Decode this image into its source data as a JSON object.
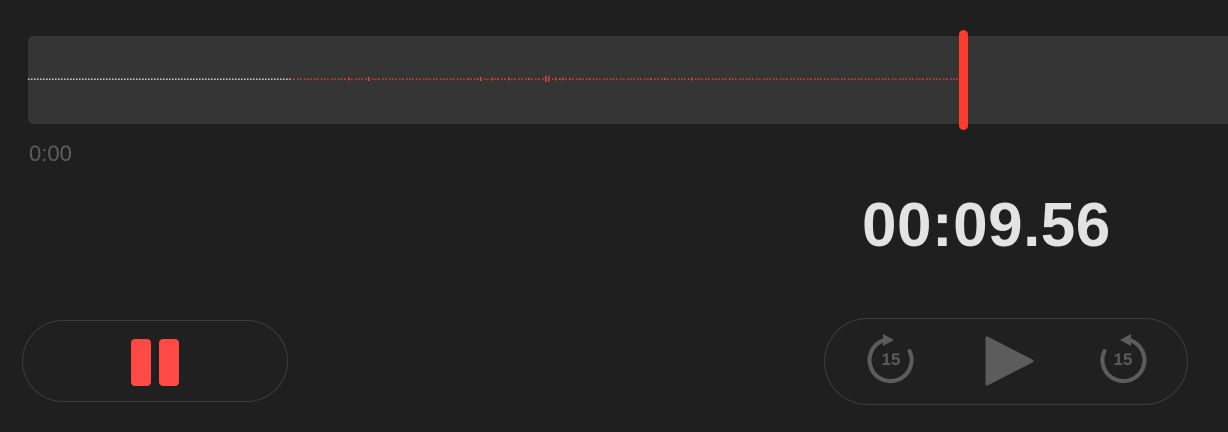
{
  "recording": {
    "start_time": "0:00",
    "elapsed_time": "00:09.56",
    "progress": 0.78
  },
  "controls": {
    "pause_icon": "pause-icon",
    "skip_back_seconds": "15",
    "skip_back_icon": "rewind-15-icon",
    "play_icon": "play-icon",
    "skip_forward_seconds": "15",
    "skip_forward_icon": "forward-15-icon"
  },
  "colors": {
    "accent": "#ff3b30",
    "pause": "#ff4a45",
    "background": "#1f1f1f",
    "track": "#353535",
    "disabled_icon": "#5c5c5c",
    "elapsed_text": "#e3e3e3"
  }
}
